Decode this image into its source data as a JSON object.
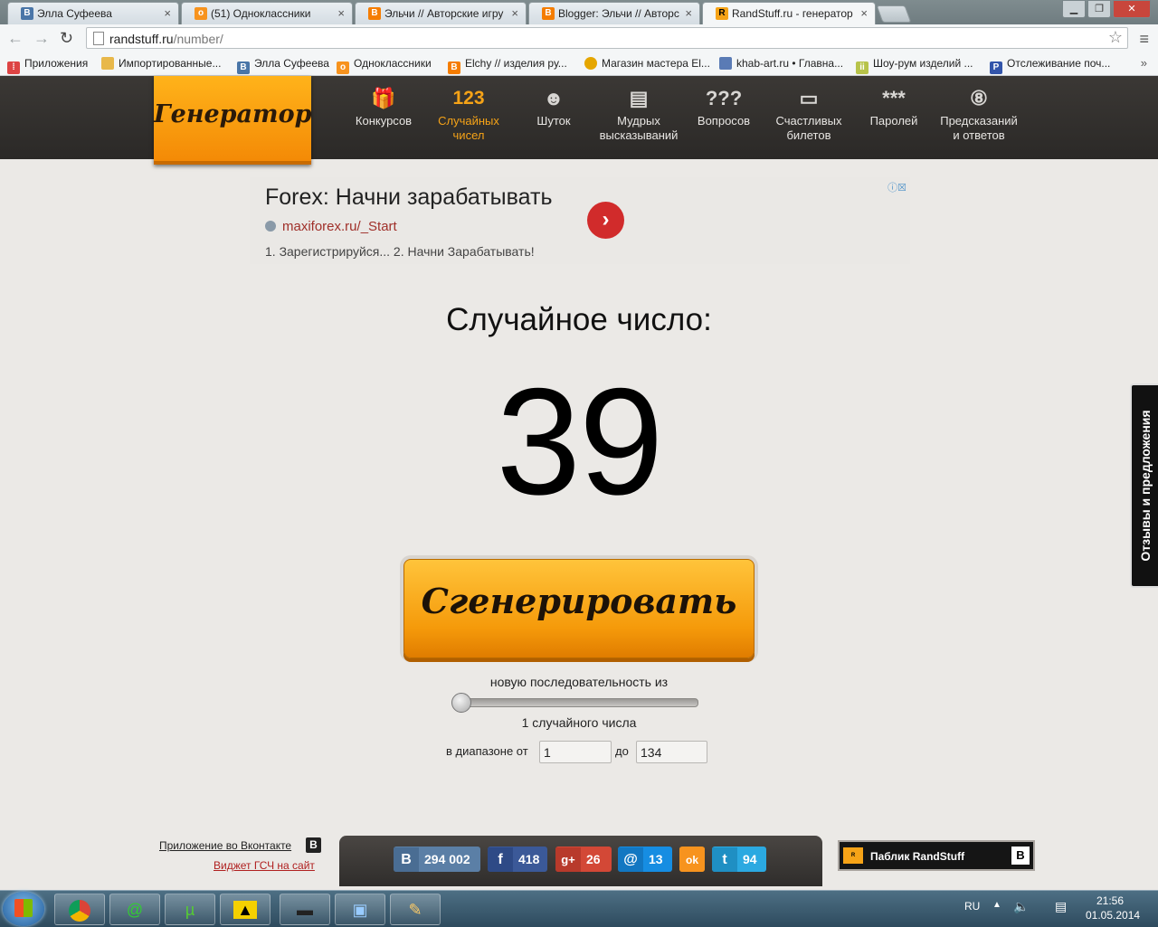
{
  "browser": {
    "tabs": [
      {
        "label": "Элла Суфеева",
        "icon": "vk-icon",
        "color": "#4a76a8",
        "glyph": "B"
      },
      {
        "label": "(51) Одноклассники",
        "icon": "ok-icon",
        "color": "#f7931e",
        "glyph": "ok"
      },
      {
        "label": "Эльчи // Авторские игру",
        "icon": "blogger-icon",
        "color": "#f57d00",
        "glyph": "B"
      },
      {
        "label": "Blogger: Эльчи // Авторс",
        "icon": "blogger-icon",
        "color": "#f57d00",
        "glyph": "B"
      },
      {
        "label": "RandStuff.ru - генератор",
        "icon": "randstuff-icon",
        "color": "#f6a317",
        "glyph": "R"
      }
    ],
    "url_host": "randstuff.ru",
    "url_path": "/number/",
    "bookmarks": [
      {
        "label": "Приложения",
        "icon": "apps-grid-icon",
        "color": "#d44"
      },
      {
        "label": "Импортированные...",
        "icon": "folder-icon",
        "color": "#e8b84a"
      },
      {
        "label": "Элла Суфеева",
        "icon": "vk-icon",
        "color": "#4a76a8"
      },
      {
        "label": "Одноклассники",
        "icon": "ok-icon",
        "color": "#f7931e"
      },
      {
        "label": "Elchy // изделия ру...",
        "icon": "blogger-icon",
        "color": "#f57d00"
      },
      {
        "label": "Магазин мастера El...",
        "icon": "shop-icon",
        "color": "#e5a600"
      },
      {
        "label": "khab-art.ru • Главна...",
        "icon": "site-icon",
        "color": "#5a7bb5"
      },
      {
        "label": "Шоу-рум изделий ...",
        "icon": "livemaster-icon",
        "color": "#b7c34a"
      },
      {
        "label": "Отслеживание поч...",
        "icon": "post-icon",
        "color": "#3355aa"
      }
    ],
    "bookmarks_more": "»"
  },
  "site": {
    "logo": "Генератор",
    "nav": [
      {
        "icon": "gift-icon",
        "glyph": "🎁",
        "label1": "Конкурсов",
        "label2": ""
      },
      {
        "icon": "numbers-icon",
        "glyph": "123",
        "label1": "Случайных",
        "label2": "чисел"
      },
      {
        "icon": "smiley-icon",
        "glyph": "☻",
        "label1": "Шуток",
        "label2": ""
      },
      {
        "icon": "quote-sheet-icon",
        "glyph": "▤",
        "label1": "Мудрых",
        "label2": "высказываний"
      },
      {
        "icon": "question-marks-icon",
        "glyph": "???",
        "label1": "Вопросов",
        "label2": ""
      },
      {
        "icon": "ticket-icon",
        "glyph": "▭",
        "label1": "Счастливых",
        "label2": "билетов"
      },
      {
        "icon": "password-stars-icon",
        "glyph": "***",
        "label1": "Паролей",
        "label2": ""
      },
      {
        "icon": "eight-ball-icon",
        "glyph": "⑧",
        "label1": "Предсказаний",
        "label2": "и ответов"
      }
    ],
    "active_nav": 1
  },
  "ad": {
    "title": "Forex: Начни зарабатывать",
    "url": "maxiforex.ru/_Start",
    "description": "1. Зарегистрируйся... 2. Начни Зарабатывать!",
    "go": "›",
    "info": "ⓘ☒"
  },
  "generator": {
    "result_label": "Случайное число:",
    "result_value": "39",
    "button_label": "Сгенерировать",
    "sequence_label": "новую последовательность из",
    "count_label": "1 случайного числа",
    "range_from_label": "в диапазоне от",
    "range_from_value": "1",
    "range_to_label": "до",
    "range_to_value": "134",
    "count_slider_value": 1
  },
  "feedback_tab": "Отзывы и предложения",
  "footer": {
    "vk_app_link": "Приложение во Вконтакте",
    "widget_link": "Виджет ГСЧ на сайт",
    "social": [
      {
        "icon": "vk-icon",
        "glyph": "B",
        "count": "294 002",
        "color": "#5b7fa6"
      },
      {
        "icon": "facebook-icon",
        "glyph": "f",
        "count": "418",
        "color": "#3b5998"
      },
      {
        "icon": "google-plus-icon",
        "glyph": "g+",
        "count": "26",
        "color": "#d34836"
      },
      {
        "icon": "mailru-icon",
        "glyph": "@",
        "count": "13",
        "color": "#168de2"
      },
      {
        "icon": "ok-icon",
        "glyph": "ok",
        "count": "",
        "color": "#f7931e"
      },
      {
        "icon": "twitter-icon",
        "glyph": "t",
        "count": "94",
        "color": "#2ba9e1"
      }
    ],
    "public_label": "Паблик RandStuff"
  },
  "taskbar": {
    "lang": "RU",
    "time": "21:56",
    "date": "01.05.2014"
  }
}
